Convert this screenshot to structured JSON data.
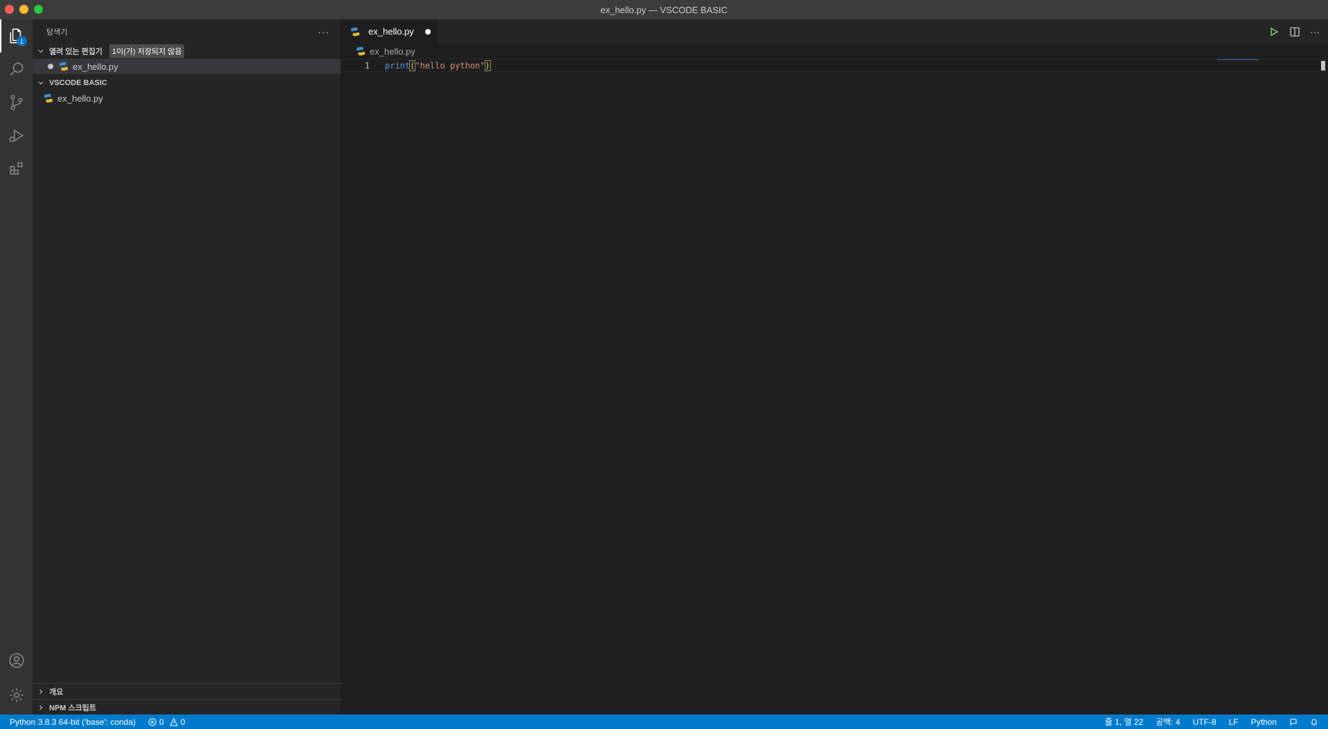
{
  "window": {
    "title": "ex_hello.py — VSCODE BASIC"
  },
  "activity": {
    "explorer_badge": "1"
  },
  "sidebar": {
    "title": "탐색기",
    "more": "···",
    "open_editors": {
      "label": "열려 있는 편집기",
      "unsaved_badge": "1이(가) 저장되지 않음",
      "items": [
        {
          "name": "ex_hello.py"
        }
      ]
    },
    "workspace": {
      "label": "VSCODE BASIC",
      "items": [
        {
          "name": "ex_hello.py"
        }
      ]
    },
    "outline_label": "개요",
    "npm_label": "NPM 스크립트"
  },
  "editor": {
    "tab_label": "ex_hello.py",
    "breadcrumb": "ex_hello.py",
    "more": "···",
    "line_number": "1",
    "code": {
      "fn": "print",
      "open_paren": "(",
      "string": "\"hello python\"",
      "close_paren": ")"
    }
  },
  "status": {
    "interpreter": "Python 3.8.3 64-bit ('base': conda)",
    "errors": "0",
    "warnings": "0",
    "position": "줄 1, 열 22",
    "spaces": "공백: 4",
    "encoding": "UTF-8",
    "eol": "LF",
    "language": "Python"
  },
  "colors": {
    "statusbar": "#007acc",
    "activitybar": "#333333",
    "sidebar": "#252526",
    "editor": "#1e1e1e"
  }
}
